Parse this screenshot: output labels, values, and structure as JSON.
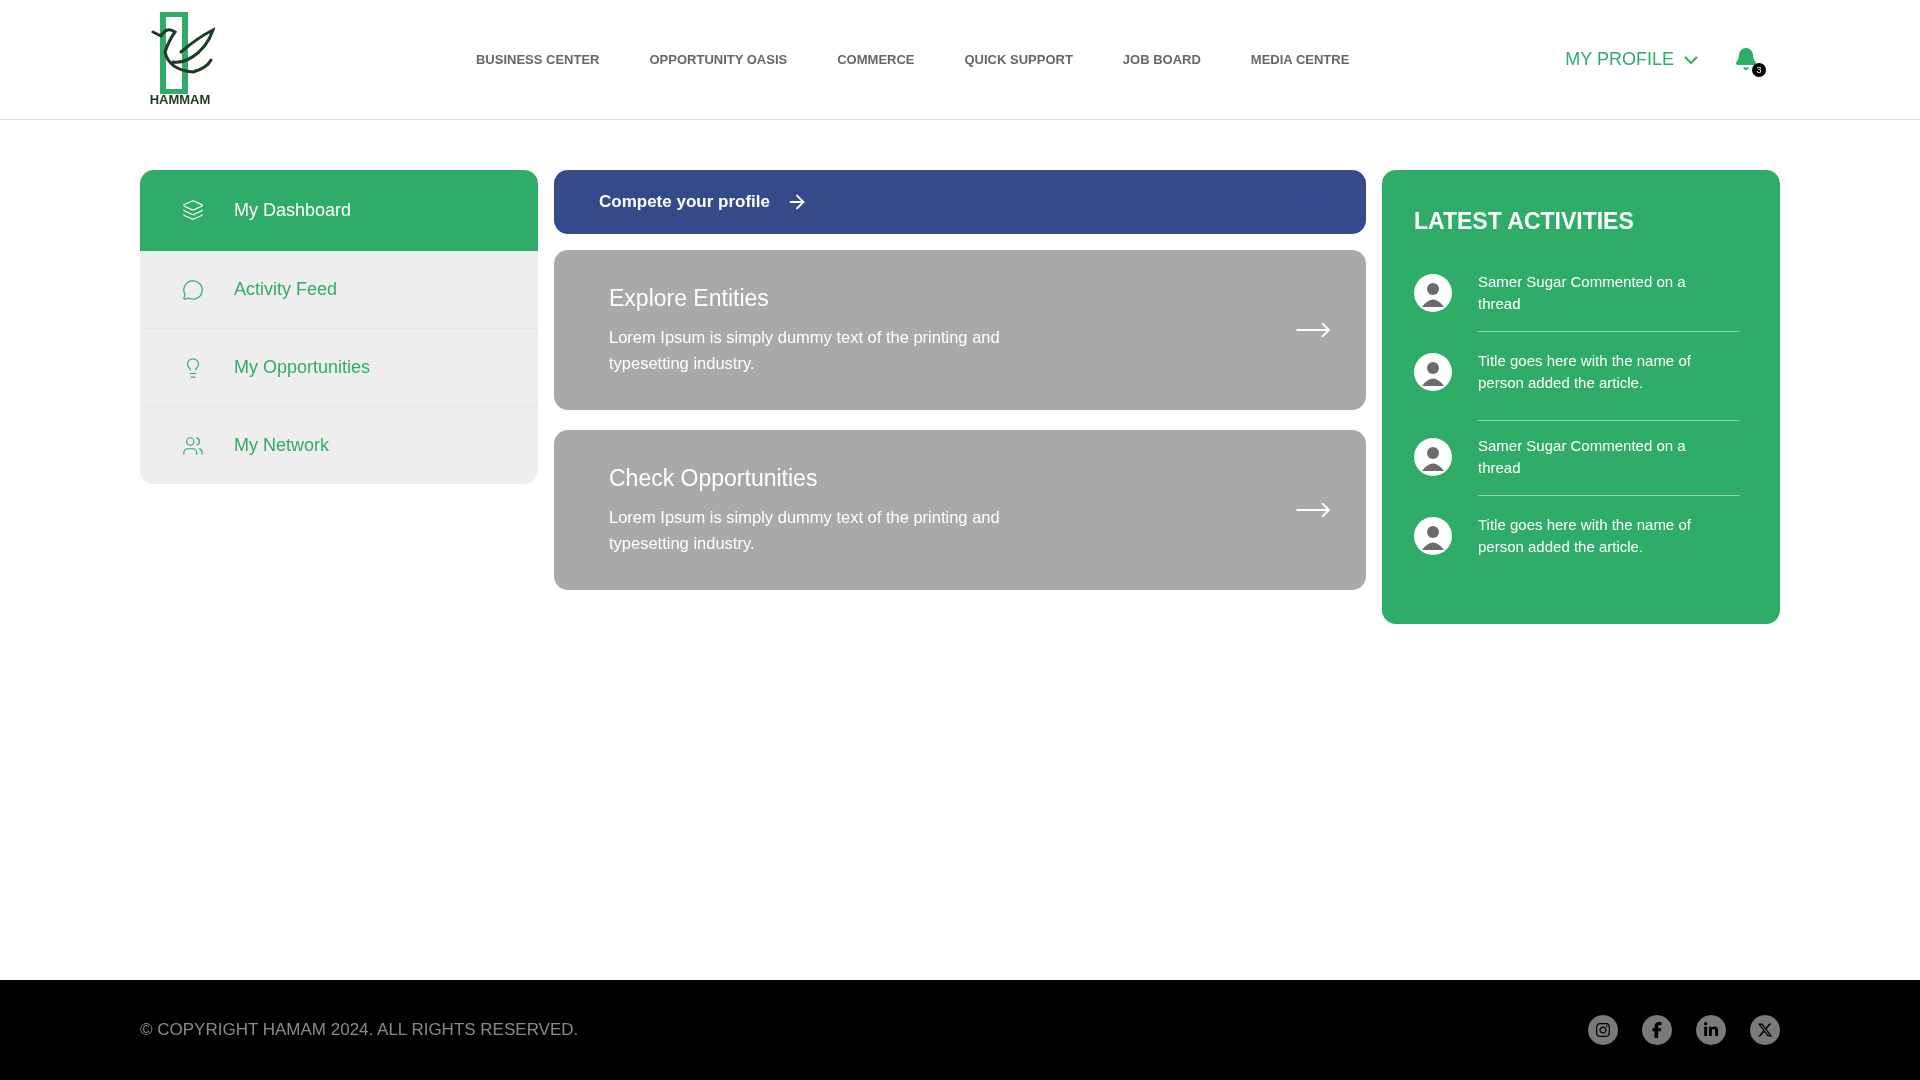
{
  "header": {
    "logo_text": "HAMMAM",
    "nav": [
      "BUSINESS CENTER",
      "OPPORTUNITY OASIS",
      "COMMERCE",
      "QUICK SUPPORT",
      "JOB BOARD",
      "MEDIA CENTRE"
    ],
    "profile": "MY PROFILE",
    "notification_count": "3"
  },
  "sidebar": {
    "items": [
      {
        "label": "My Dashboard",
        "selected": true
      },
      {
        "label": "Activity Feed",
        "selected": false
      },
      {
        "label": "My Opportunities",
        "selected": false
      },
      {
        "label": "My Network",
        "selected": false
      }
    ]
  },
  "banner": {
    "text": "Compete your profile"
  },
  "cards": [
    {
      "title": "Explore Entities",
      "text": "Lorem Ipsum is simply dummy text of the printing and typesetting industry."
    },
    {
      "title": "Check Opportunities",
      "text": "Lorem Ipsum is simply dummy text of the printing and typesetting industry."
    }
  ],
  "activities": {
    "title": "LATEST ACTIVITIES",
    "items": [
      {
        "text": "Samer Sugar Commented on a thread"
      },
      {
        "text": "Title goes here with the name of person added the article."
      },
      {
        "text": "Samer Sugar Commented on a thread"
      },
      {
        "text": "Title goes here with the name of person added the article."
      }
    ]
  },
  "footer": {
    "copyright": "© COPYRIGHT HAMAM 2024. ALL RIGHTS RESERVED."
  }
}
